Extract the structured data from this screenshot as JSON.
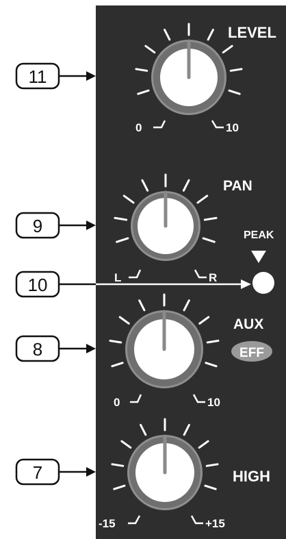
{
  "colors": {
    "panel": "#2e2e2e",
    "knob_ring": "#8f8f8f",
    "knob_face": "#ffffff",
    "tick": "#ffffff",
    "callout_stroke": "#111111",
    "eff_badge": "#9a9a9a"
  },
  "callouts": [
    {
      "label": "11",
      "target": "level-knob"
    },
    {
      "label": "9",
      "target": "pan-knob"
    },
    {
      "label": "10",
      "target": "peak-led"
    },
    {
      "label": "8",
      "target": "aux-knob"
    },
    {
      "label": "7",
      "target": "high-knob"
    }
  ],
  "knobs": [
    {
      "name": "level",
      "label": "LEVEL",
      "min_label": "0",
      "max_label": "10"
    },
    {
      "name": "pan",
      "label": "PAN",
      "min_label": "L",
      "max_label": "R"
    },
    {
      "name": "aux",
      "label": "AUX",
      "badge": "EFF",
      "min_label": "0",
      "max_label": "10"
    },
    {
      "name": "high",
      "label": "HIGH",
      "min_label": "-15",
      "max_label": "+15"
    }
  ],
  "peak": {
    "label": "PEAK",
    "arrow_icon": "down-triangle-icon"
  }
}
